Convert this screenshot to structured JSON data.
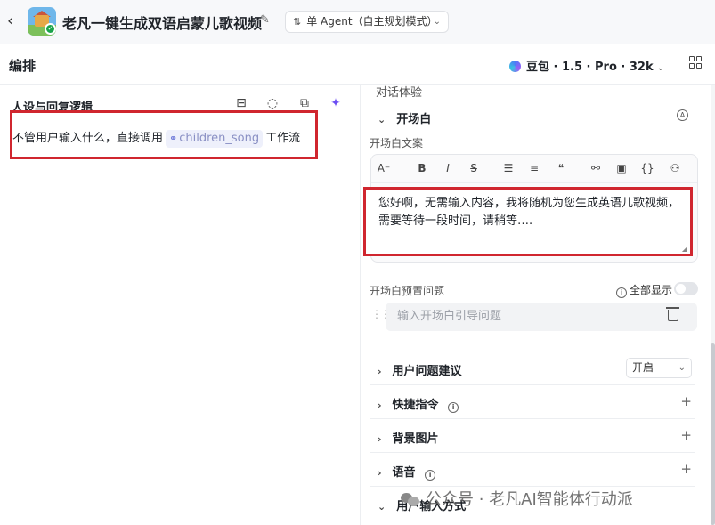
{
  "header": {
    "back_glyph": "‹",
    "bot_title": "老凡一键生成双语启蒙儿歌视频",
    "mode_label": "单 Agent（自主规划模式）"
  },
  "subbar": {
    "title": "编排",
    "model_name": "豆包 · 1.5 · Pro · 32k"
  },
  "left_panel": {
    "section_title": "人设与回复逻辑",
    "prompt_prefix": "不管用户输入什么，直接调用",
    "workflow_name": "children_song",
    "prompt_suffix": "工作流"
  },
  "right_panel": {
    "partial_heading": "对话体验",
    "opening_heading": "开场白",
    "opening_copy_label": "开场白文案",
    "opening_text": "您好啊，无需输入内容，我将随机为您生成英语儿歌视频，需要等待一段时间，请稍等….",
    "preset_label": "开场白预置问题",
    "show_all_label": "全部显示",
    "preset_placeholder": "输入开场白引导问题",
    "rows": {
      "user_suggestion": "用户问题建议",
      "user_suggestion_value": "开启",
      "shortcuts": "快捷指令",
      "background": "背景图片",
      "voice": "语音",
      "input_mode": "用户输入方式"
    }
  },
  "watermark": "公众号 · 老凡AI智能体行动派",
  "icons": {
    "toolbar": [
      "font-size-icon",
      "bold-icon",
      "italic-icon",
      "strikethrough-icon",
      "bullet-list-icon",
      "numbered-list-icon",
      "quote-icon",
      "link-icon",
      "image-icon",
      "code-block-icon",
      "user-icon"
    ]
  },
  "colors": {
    "highlight_red": "#d0262f",
    "accent_purple": "#6b4df2",
    "workflow_chip_bg": "#eef0fb"
  }
}
